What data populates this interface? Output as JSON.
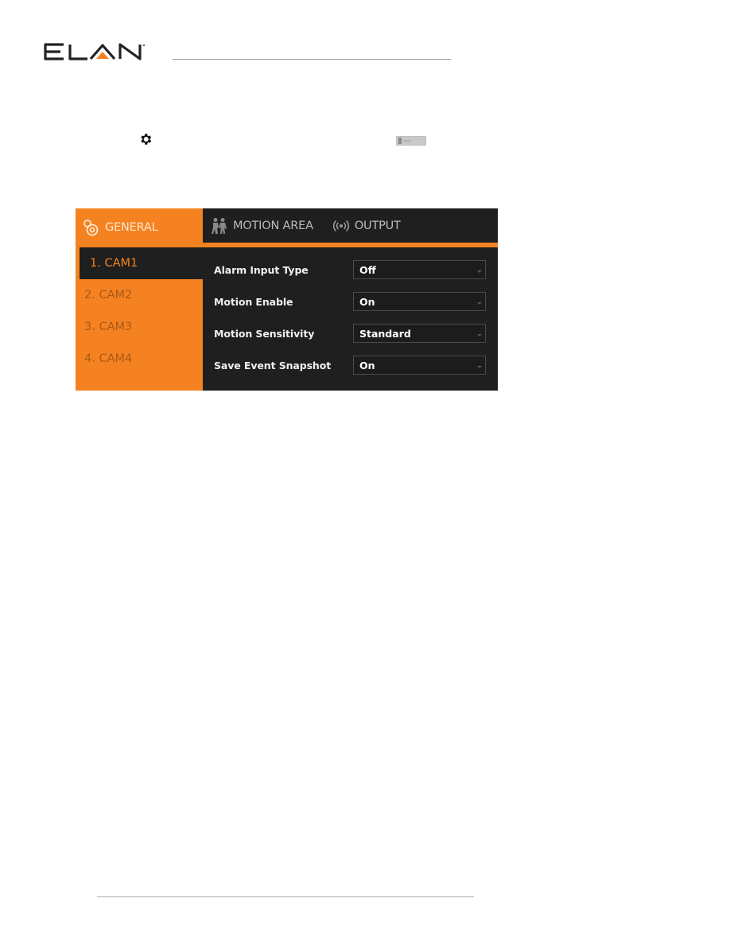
{
  "brand": {
    "name": "ELAN",
    "accent_color": "#f58220"
  },
  "toolbar": {
    "mini_button_label": "setup"
  },
  "panel": {
    "tabs": [
      {
        "id": "general",
        "label": "GENERAL",
        "icon": "gears-icon",
        "active": true
      },
      {
        "id": "motion_area",
        "label": "MOTION AREA",
        "icon": "people-motion-icon",
        "active": false
      },
      {
        "id": "output",
        "label": "OUTPUT",
        "icon": "broadcast-icon",
        "active": false
      }
    ],
    "cameras": [
      {
        "label": "1. CAM1",
        "active": true
      },
      {
        "label": "2. CAM2",
        "active": false
      },
      {
        "label": "3. CAM3",
        "active": false
      },
      {
        "label": "4. CAM4",
        "active": false
      }
    ],
    "settings": [
      {
        "label": "Alarm Input Type",
        "value": "Off"
      },
      {
        "label": "Motion Enable",
        "value": "On"
      },
      {
        "label": "Motion Sensitivity",
        "value": "Standard"
      },
      {
        "label": "Save Event Snapshot",
        "value": "On"
      }
    ]
  },
  "colors": {
    "panel_bg": "#1f1f1f",
    "accent": "#f58220",
    "tab_text": "#bcbcbc",
    "inactive_cam_text": "#a85a16"
  }
}
